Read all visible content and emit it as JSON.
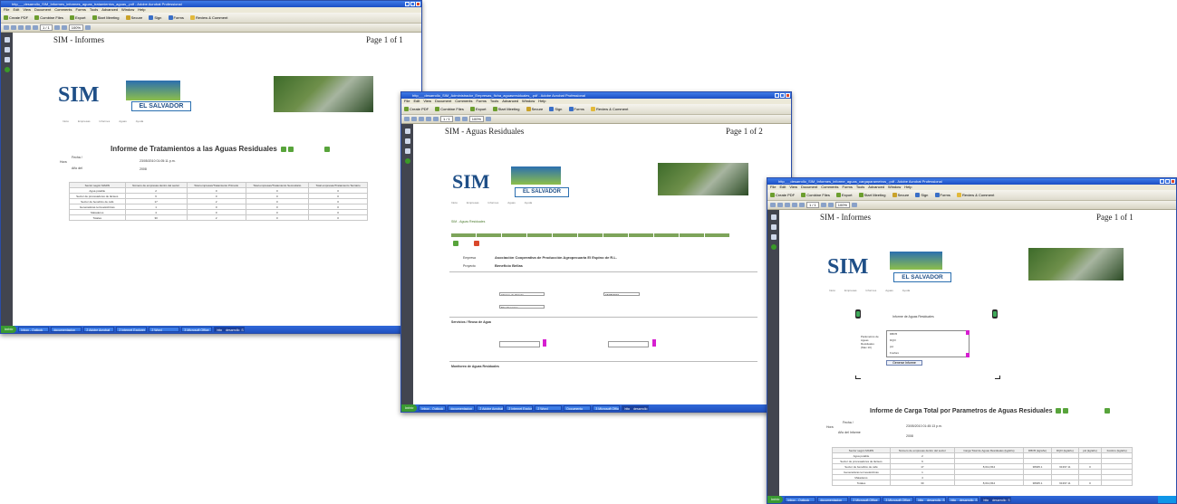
{
  "windows": [
    {
      "id": "w1",
      "title": "http___desarrollo_SIM_Informes_informes_aguas_tratamientos_aguas_.pdf - Adobe Acrobat Professional",
      "page_header": "SIM - Informes",
      "page_count": "Page 1 of 1",
      "report_title": "Informe de Tratamientos a las Aguas Residuales",
      "fecha_label": "Fecha /",
      "fecha_value": "23/05/2010 01:05:11 p.m.",
      "hora_label": "Hora",
      "anio_label": "Año del",
      "anio_value": "2008",
      "table_headers": [
        "Sector según MARN",
        "Número de empresas dentro del sector",
        "Total empresas/Tratamiento Primario",
        "Total empresas/Tratamiento Secundario",
        "Total empresas/Tratamiento Terciario"
      ],
      "table_rows": [
        [
          "Agua potable",
          "2",
          "0",
          "0",
          "0"
        ],
        [
          "Sector de procesadores de lácteos",
          "6",
          "0",
          "0",
          "0"
        ],
        [
          "Sector de beneficio de café",
          "17",
          "2",
          "0",
          "0"
        ],
        [
          "Generadoras termoeléctricas",
          "1",
          "0",
          "0",
          "0"
        ],
        [
          "Mataderos",
          "4",
          "0",
          "0",
          "0"
        ],
        [
          "Totales",
          "30",
          "2",
          "0",
          "0"
        ]
      ]
    },
    {
      "id": "w2",
      "title": "http___desarrollo_SIM_Administrador_Empresas_ficha_aguasresiduales_.pdf - Adobe Acrobat Professional",
      "page_header": "SIM - Aguas Residuales",
      "page_count": "Page 1 of 2",
      "breadcrumb": "SIM - Aguas Residuales",
      "empresa_label": "Empresa",
      "empresa_value": "Asociación Cooperativa de Producción Agropecuaria El Espino de R.L.",
      "proyecto_label": "Proyecto",
      "proyecto_value": "Beneficio Bellas",
      "section1": "Servicios / Reuso de Agua",
      "section2": "Monitoreo de Aguas Residuales",
      "fuente_value": "Informe de Tramite",
      "tipo_value": "Tipo P cuerpo",
      "fecha_value": "15/05/2010"
    },
    {
      "id": "w3",
      "title": "http___desarrollo_SIM_Informes_informe_aguas_cargaparametros_.pdf - Adobe Acrobat Professional",
      "page_header": "SIM - Informes",
      "page_count": "Page 1 of 1",
      "form_title": "Informe de Aguas Residuales",
      "param_label": "Parámetros de Aguas Residuales (Max 10)",
      "params": [
        "DBO5",
        "DQO",
        "pH",
        "Fosforo"
      ],
      "button_label": "Generar Informe",
      "report_title": "Informe de Carga Total por Parametros de Aguas Residuales",
      "fecha_label": "Fecha /",
      "fecha_value": "23/05/2010 01:45:13 p.m.",
      "hora_label": "Hora",
      "anio_label": "Año del Informe",
      "anio_value": "2008",
      "table_headers": [
        "Sector según MARN",
        "Número de empresas dentro del sector",
        "Carga Total de Aguas Residuales (kg/año)",
        "DBO5 (kg/año)",
        "DQO (kg/año)",
        "pH (kg/año)",
        "Fosforo (kg/año)"
      ],
      "table_rows": [
        [
          "Agua potable",
          "2",
          "",
          "",
          "",
          "",
          ""
        ],
        [
          "Sector de procesadores de lácteos",
          "6",
          "",
          "",
          "",
          "",
          ""
        ],
        [
          "Sector de beneficio de café",
          "17",
          "8,012,844",
          "38945.1",
          "61397.11",
          "0",
          ""
        ],
        [
          "Generadoras termoeléctricas",
          "1",
          "",
          "",
          "",
          "",
          ""
        ],
        [
          "Mataderos",
          "4",
          "",
          "",
          "",
          "",
          ""
        ],
        [
          "Totales",
          "30",
          "8,012,844",
          "38945.1",
          "61397.11",
          "0",
          ""
        ]
      ]
    }
  ],
  "menu_items": [
    "File",
    "Edit",
    "View",
    "Document",
    "Comments",
    "Forms",
    "Tools",
    "Advanced",
    "Window",
    "Help"
  ],
  "toolbar_items": [
    "Create PDF",
    "Combine Files",
    "Export",
    "Start Meeting",
    "Secure",
    "Sign",
    "Forms",
    "Review & Comment"
  ],
  "zoom": "100%",
  "page_nav": "1 / 1",
  "logo": {
    "sim": "SIM",
    "country": "EL SALVADOR"
  },
  "start_label": "Inicio",
  "taskbar_items_w1": [
    "Inbox - Outlook",
    "documentacion",
    "2 Adobe Acrobat",
    "2 Internet Explorer",
    "2 Word",
    "3 Microsoft Office",
    "http__desarrollo_SIM"
  ],
  "taskbar_items_w2": [
    "Inbox - Outlook",
    "documentacion",
    "2 Adobe Acrobat",
    "2 Internet Explorer",
    "2 Word",
    "Documento",
    "3 Microsoft Office",
    "http__desarrollo_SIM"
  ],
  "taskbar_items_w3": [
    "Inbox - Outlook",
    "documentacion",
    "2 Microsoft Office",
    "3 Microsoft Office",
    "http__desarrollo_SIM",
    "http__desarrollo_SIM",
    "http__desarrollo_SIM"
  ],
  "colors": {
    "titlebar": "#1b4fc4",
    "taskbar": "#2051c0",
    "nav_dark": "#42454f",
    "accent_green": "#58a43b",
    "accent_pink": "#d61fd0"
  }
}
